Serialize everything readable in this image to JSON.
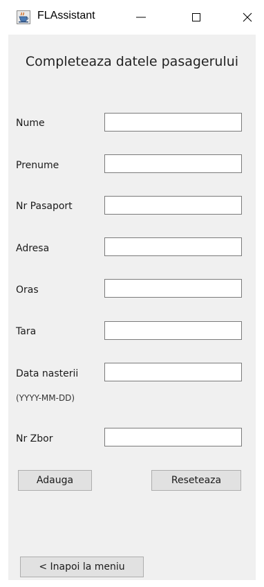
{
  "window": {
    "title": "FLAssistant",
    "icon": "java-cup-icon"
  },
  "form": {
    "heading": "Completeaza datele pasagerului",
    "fields": [
      {
        "label": "Nume",
        "value": "",
        "placeholder": ""
      },
      {
        "label": "Prenume",
        "value": "",
        "placeholder": ""
      },
      {
        "label": "Nr Pasaport",
        "value": "",
        "placeholder": ""
      },
      {
        "label": "Adresa",
        "value": "",
        "placeholder": ""
      },
      {
        "label": "Oras",
        "value": "",
        "placeholder": ""
      },
      {
        "label": "Tara",
        "value": "",
        "placeholder": ""
      },
      {
        "label": "Data nasterii",
        "hint": "(YYYY-MM-DD)",
        "value": "",
        "placeholder": ""
      },
      {
        "label": "Nr Zbor",
        "value": "",
        "placeholder": ""
      }
    ],
    "add_label": "Adauga",
    "reset_label": "Reseteaza",
    "back_label": "< Inapoi la meniu"
  },
  "colors": {
    "client_background": "#f0f0f0",
    "button_background": "#e1e1e1",
    "field_border": "#7a7a7a"
  }
}
